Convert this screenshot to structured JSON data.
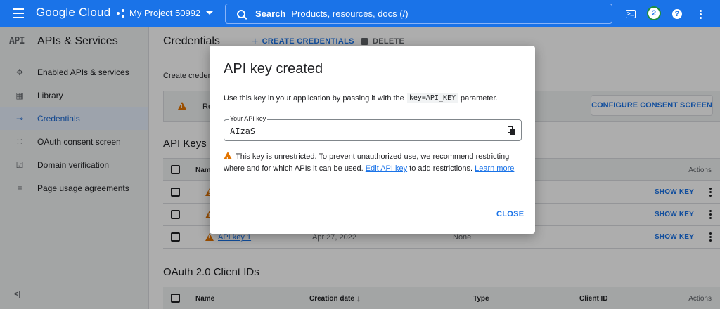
{
  "topbar": {
    "logo": "Google Cloud",
    "project": "My Project 50992",
    "search_label": "Search",
    "search_placeholder": "Products, resources, docs (/)",
    "notification_count": "2",
    "help": "?"
  },
  "sidebar": {
    "logo": "API",
    "title": "APIs & Services",
    "items": [
      {
        "label": "Enabled APIs & services",
        "icon": "diamond-icon"
      },
      {
        "label": "Library",
        "icon": "library-icon"
      },
      {
        "label": "Credentials",
        "icon": "key-icon",
        "active": true
      },
      {
        "label": "OAuth consent screen",
        "icon": "consent-icon"
      },
      {
        "label": "Domain verification",
        "icon": "checkbox-icon"
      },
      {
        "label": "Page usage agreements",
        "icon": "settings-list-icon"
      }
    ],
    "collapse": "<|"
  },
  "main": {
    "title": "Credentials",
    "create_credentials": "CREATE CREDENTIALS",
    "delete": "DELETE",
    "create_text": "Create creden",
    "banner_text": "Re",
    "consent_button": "CONFIGURE CONSENT SCREEN",
    "api_keys_title": "API Keys",
    "api_keys_head": {
      "name": "Nam",
      "actions": "Actions"
    },
    "api_keys_rows": [
      {
        "name": "",
        "date": "",
        "restrictions": "",
        "show_key": "SHOW KEY"
      },
      {
        "name": "",
        "date": "",
        "restrictions": "",
        "show_key": "SHOW KEY"
      },
      {
        "name": "API key 1",
        "date": "Apr 27, 2022",
        "restrictions": "None",
        "show_key": "SHOW KEY"
      }
    ],
    "oauth_title": "OAuth 2.0 Client IDs",
    "oauth_head": {
      "name": "Name",
      "creation_date": "Creation date",
      "type": "Type",
      "client_id": "Client ID",
      "actions": "Actions"
    }
  },
  "dialog": {
    "title": "API key created",
    "desc_before": "Use this key in your application by passing it with the",
    "desc_code": "key=API_KEY",
    "desc_after": "parameter.",
    "field_label": "Your API key",
    "field_value": "AIzaS",
    "warning_text": "This key is unrestricted. To prevent unauthorized use, we recommend restricting where and for which APIs it can be used.",
    "edit_link": "Edit API key",
    "warning_mid": "to add restrictions.",
    "learn_more": "Learn more",
    "close": "CLOSE"
  },
  "colors": {
    "brand": "#1a73e8",
    "warning": "#e37400",
    "sidebar_bg": "#f1f3f4"
  }
}
